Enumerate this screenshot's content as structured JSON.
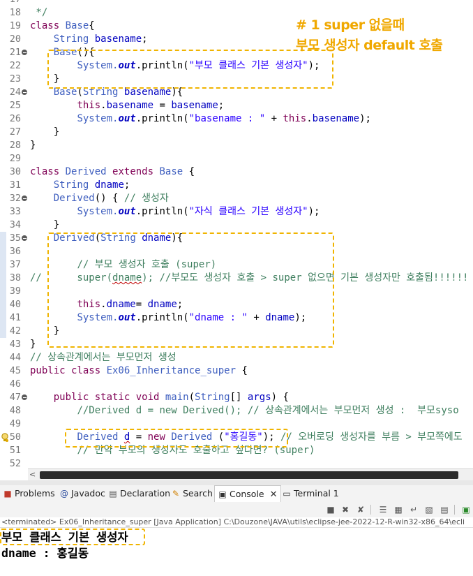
{
  "editor": {
    "lines": [
      {
        "n": "17",
        "segs": [
          {
            "t": ""
          }
        ]
      },
      {
        "n": "18",
        "segs": [
          {
            "t": " */",
            "c": "cm"
          }
        ]
      },
      {
        "n": "19",
        "segs": [
          {
            "t": "class ",
            "c": "kw"
          },
          {
            "t": "Base",
            "c": "cl"
          },
          {
            "t": "{"
          }
        ]
      },
      {
        "n": "20",
        "segs": [
          {
            "t": "    "
          },
          {
            "t": "String",
            "c": "cl"
          },
          {
            "t": " "
          },
          {
            "t": "basename",
            "c": "fd"
          },
          {
            "t": ";"
          }
        ]
      },
      {
        "n": "21",
        "fold": true,
        "segs": [
          {
            "t": "    "
          },
          {
            "t": "Base",
            "c": "cl"
          },
          {
            "t": "(){"
          }
        ]
      },
      {
        "n": "22",
        "segs": [
          {
            "t": "        "
          },
          {
            "t": "System.",
            "c": "cl"
          },
          {
            "t": "out",
            "c": "fd it"
          },
          {
            "t": ".println("
          },
          {
            "t": "\"부모 클래스 기본 생성자\"",
            "c": "st"
          },
          {
            "t": ");"
          }
        ]
      },
      {
        "n": "23",
        "segs": [
          {
            "t": "    }"
          }
        ]
      },
      {
        "n": "24",
        "fold": true,
        "segs": [
          {
            "t": "    "
          },
          {
            "t": "Base",
            "c": "cl"
          },
          {
            "t": "("
          },
          {
            "t": "String",
            "c": "cl"
          },
          {
            "t": " "
          },
          {
            "t": "basename",
            "c": "fd"
          },
          {
            "t": "){"
          }
        ]
      },
      {
        "n": "25",
        "segs": [
          {
            "t": "        "
          },
          {
            "t": "this",
            "c": "kw"
          },
          {
            "t": "."
          },
          {
            "t": "basename",
            "c": "fd"
          },
          {
            "t": " = "
          },
          {
            "t": "basename",
            "c": "fd"
          },
          {
            "t": ";"
          }
        ]
      },
      {
        "n": "26",
        "segs": [
          {
            "t": "        "
          },
          {
            "t": "System.",
            "c": "cl"
          },
          {
            "t": "out",
            "c": "fd it"
          },
          {
            "t": ".println("
          },
          {
            "t": "\"basename : \"",
            "c": "st"
          },
          {
            "t": " + "
          },
          {
            "t": "this",
            "c": "kw"
          },
          {
            "t": "."
          },
          {
            "t": "basename",
            "c": "fd"
          },
          {
            "t": ");"
          }
        ]
      },
      {
        "n": "27",
        "segs": [
          {
            "t": "    }"
          }
        ]
      },
      {
        "n": "28",
        "segs": [
          {
            "t": "}"
          }
        ]
      },
      {
        "n": "29",
        "segs": [
          {
            "t": ""
          }
        ]
      },
      {
        "n": "30",
        "segs": [
          {
            "t": "class ",
            "c": "kw"
          },
          {
            "t": "Derived",
            "c": "cl"
          },
          {
            "t": " "
          },
          {
            "t": "extends",
            "c": "kw"
          },
          {
            "t": " "
          },
          {
            "t": "Base",
            "c": "cl"
          },
          {
            "t": " {"
          }
        ]
      },
      {
        "n": "31",
        "segs": [
          {
            "t": "    "
          },
          {
            "t": "String",
            "c": "cl"
          },
          {
            "t": " "
          },
          {
            "t": "dname",
            "c": "fd"
          },
          {
            "t": ";"
          }
        ]
      },
      {
        "n": "32",
        "fold": true,
        "segs": [
          {
            "t": "    "
          },
          {
            "t": "Derived",
            "c": "cl"
          },
          {
            "t": "() { "
          },
          {
            "t": "// 생성자",
            "c": "cm"
          }
        ]
      },
      {
        "n": "33",
        "segs": [
          {
            "t": "        "
          },
          {
            "t": "System.",
            "c": "cl"
          },
          {
            "t": "out",
            "c": "fd it"
          },
          {
            "t": ".println("
          },
          {
            "t": "\"자식 클래스 기본 생성자\"",
            "c": "st"
          },
          {
            "t": ");"
          }
        ]
      },
      {
        "n": "34",
        "segs": [
          {
            "t": "    }"
          }
        ]
      },
      {
        "n": "35",
        "fold": true,
        "mark": true,
        "segs": [
          {
            "t": "    "
          },
          {
            "t": "Derived",
            "c": "cl"
          },
          {
            "t": "("
          },
          {
            "t": "String",
            "c": "cl"
          },
          {
            "t": " "
          },
          {
            "t": "dname",
            "c": "fd"
          },
          {
            "t": "){"
          }
        ]
      },
      {
        "n": "36",
        "mark": true,
        "segs": [
          {
            "t": ""
          }
        ]
      },
      {
        "n": "37",
        "mark": true,
        "segs": [
          {
            "t": "        "
          },
          {
            "t": "// 부모 생성자 호출 (super)",
            "c": "cm"
          }
        ]
      },
      {
        "n": "38",
        "mark": true,
        "segs": [
          {
            "t": "//      super(",
            "c": "cm"
          },
          {
            "t": "dname",
            "c": "cm wavy"
          },
          {
            "t": "); //부모도 생성자 호출 > super 없으면 기본 생성자만 호출됨!!!!!!",
            "c": "cm"
          }
        ]
      },
      {
        "n": "39",
        "mark": true,
        "segs": [
          {
            "t": ""
          }
        ]
      },
      {
        "n": "40",
        "mark": true,
        "segs": [
          {
            "t": "        "
          },
          {
            "t": "this",
            "c": "kw"
          },
          {
            "t": "."
          },
          {
            "t": "dname",
            "c": "fd"
          },
          {
            "t": "= "
          },
          {
            "t": "dname",
            "c": "fd"
          },
          {
            "t": ";"
          }
        ]
      },
      {
        "n": "41",
        "mark": true,
        "segs": [
          {
            "t": "        "
          },
          {
            "t": "System.",
            "c": "cl"
          },
          {
            "t": "out",
            "c": "fd it"
          },
          {
            "t": ".println("
          },
          {
            "t": "\"dname : \"",
            "c": "st"
          },
          {
            "t": " + "
          },
          {
            "t": "dname",
            "c": "fd"
          },
          {
            "t": ");"
          }
        ]
      },
      {
        "n": "42",
        "mark": true,
        "segs": [
          {
            "t": "    }"
          }
        ]
      },
      {
        "n": "43",
        "segs": [
          {
            "t": "}"
          }
        ]
      },
      {
        "n": "44",
        "segs": [
          {
            "t": "// 상속관계에서는 부모먼저 생성",
            "c": "cm"
          }
        ]
      },
      {
        "n": "45",
        "segs": [
          {
            "t": "public class ",
            "c": "kw"
          },
          {
            "t": "Ex06_Inheritance_super",
            "c": "cl"
          },
          {
            "t": " {"
          }
        ]
      },
      {
        "n": "46",
        "segs": [
          {
            "t": ""
          }
        ]
      },
      {
        "n": "47",
        "fold": true,
        "segs": [
          {
            "t": "    "
          },
          {
            "t": "public static void ",
            "c": "kw"
          },
          {
            "t": "main",
            "c": "cl"
          },
          {
            "t": "("
          },
          {
            "t": "String",
            "c": "cl"
          },
          {
            "t": "[] "
          },
          {
            "t": "args",
            "c": "fd"
          },
          {
            "t": ") {"
          }
        ]
      },
      {
        "n": "48",
        "segs": [
          {
            "t": "        "
          },
          {
            "t": "//Derived d = new Derived(); // 상속관계에서는 부모먼저 생성 :  부모syso",
            "c": "cm"
          }
        ]
      },
      {
        "n": "49",
        "segs": [
          {
            "t": ""
          }
        ]
      },
      {
        "n": "50",
        "bulb": true,
        "segs": [
          {
            "t": "        "
          },
          {
            "t": "Derived",
            "c": "cl"
          },
          {
            "t": " "
          },
          {
            "t": "d",
            "c": "fd wavy"
          },
          {
            "t": " = "
          },
          {
            "t": "new ",
            "c": "kw"
          },
          {
            "t": "Derived",
            "c": "cl"
          },
          {
            "t": " ("
          },
          {
            "t": "\"홍길동\"",
            "c": "st"
          },
          {
            "t": "); "
          },
          {
            "t": "// 오버로딩 생성자를 부름 > 부모쪽에도",
            "c": "cm"
          }
        ]
      },
      {
        "n": "51",
        "segs": [
          {
            "t": "        "
          },
          {
            "t": "// 만약 부모의 생성자도 호출하고 싶다면? (super)",
            "c": "cm"
          }
        ]
      },
      {
        "n": "52",
        "segs": [
          {
            "t": ""
          }
        ]
      }
    ]
  },
  "annotation": {
    "line1": "# 1 super 없을때",
    "line2": "부모 생성자 default 호출"
  },
  "bottom_panel": {
    "tabs": [
      {
        "label": "Problems",
        "icon": "problems-icon"
      },
      {
        "label": "Javadoc",
        "icon": "javadoc-icon"
      },
      {
        "label": "Declaration",
        "icon": "declaration-icon"
      },
      {
        "label": "Search",
        "icon": "search-icon"
      },
      {
        "label": "Console",
        "icon": "console-icon",
        "active": true
      },
      {
        "label": "Terminal 1",
        "icon": "terminal-icon"
      }
    ],
    "console_header": "<terminated> Ex06_Inheritance_super [Java Application] C:\\Douzone\\JAVA\\utils\\eclipse-jee-2022-12-R-win32-x86_64\\ecli",
    "output": [
      "부모 클래스 기본 생성자",
      "dname : 홍길동"
    ]
  },
  "colors": {
    "keyword": "#7f0055",
    "class_name": "#3f5fbf",
    "comment": "#3f7f5f",
    "string": "#2a00ff",
    "field": "#0000c0",
    "highlight_box": "#f0b400",
    "annotation": "#f0a800"
  }
}
